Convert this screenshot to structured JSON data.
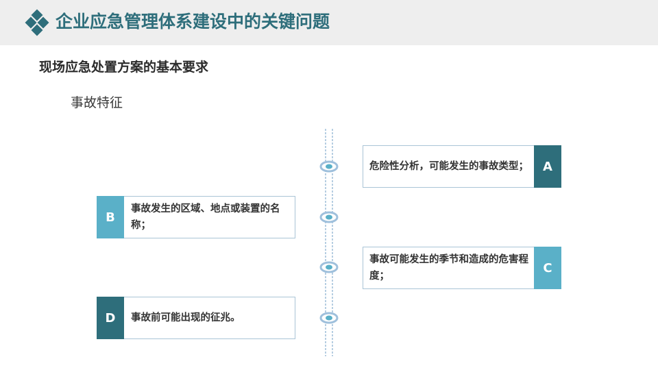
{
  "header": {
    "title": "企业应急管理体系建设中的关键问题",
    "logo_icon": "diamond-cluster-icon"
  },
  "subtitle": "现场应急处置方案的基本要求",
  "section_title": "事故特征",
  "colors": {
    "dark_teal": "#2e6e7b",
    "light_teal": "#5ab0c8",
    "line": "#6e9ec6"
  },
  "items": [
    {
      "badge": "A",
      "text": "危险性分析，可能发生的事故类型；"
    },
    {
      "badge": "B",
      "text": "事故发生的区域、地点或装置的名称；"
    },
    {
      "badge": "C",
      "text": "事故可能发生的季节和造成的危害程度；"
    },
    {
      "badge": "D",
      "text": "事故前可能出现的征兆。"
    }
  ]
}
